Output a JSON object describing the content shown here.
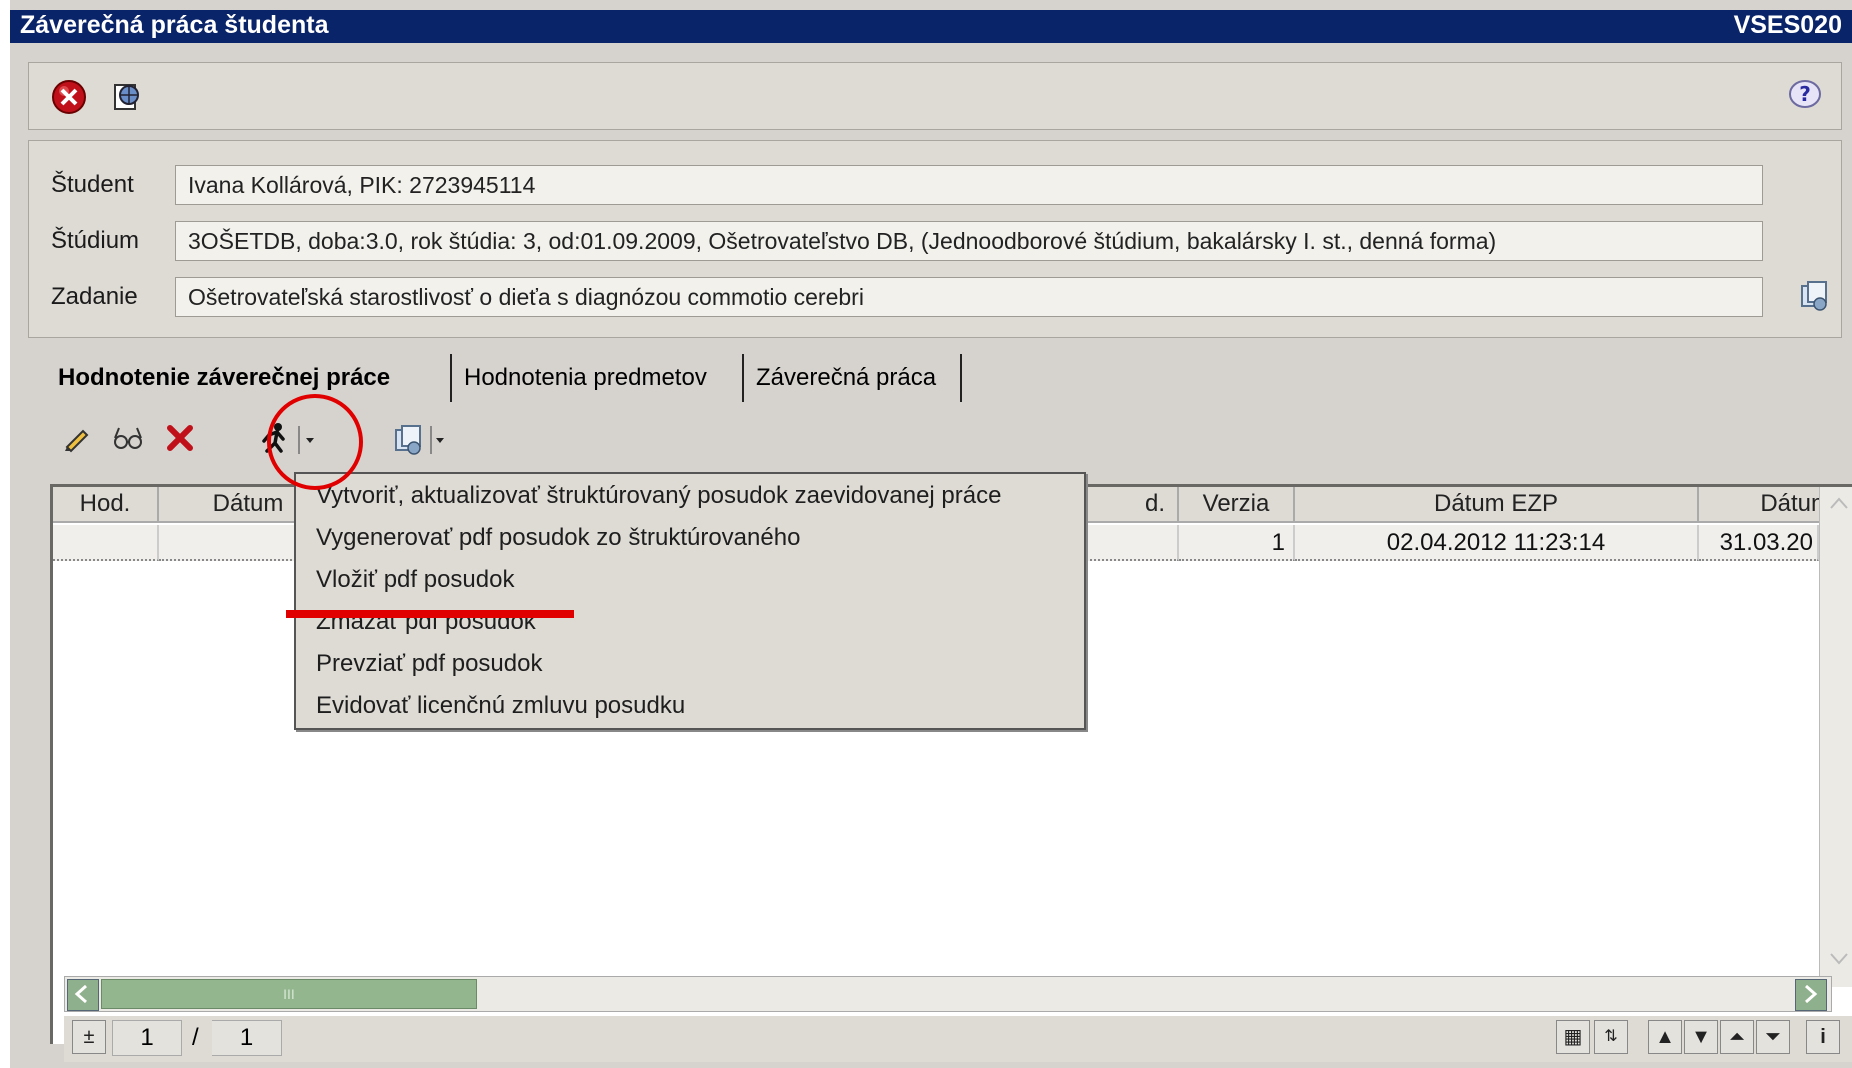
{
  "window": {
    "title": "Záverečná práca študenta",
    "code": "VSES020"
  },
  "top_toolbar": {
    "icons": [
      "close-red-icon",
      "world-report-icon",
      "help-icon"
    ]
  },
  "info": {
    "student_label": "Študent",
    "student_value": "Ivana Kollárová, PIK: 2723945114",
    "studium_label": "Štúdium",
    "studium_value": "3OŠETDB, doba:3.0, rok štúdia: 3, od:01.09.2009, Ošetrovateľstvo DB, (Jednoodborové štúdium, bakalársky I. st., denná forma)",
    "zadanie_label": "Zadanie",
    "zadanie_value": "Ošetrovateľská starostlivosť o dieťa s diagnózou commotio cerebri"
  },
  "tabs": [
    {
      "label": "Hodnotenie záverečnej práce",
      "active": true
    },
    {
      "label": "Hodnotenia predmetov",
      "active": false
    },
    {
      "label": "Záverečná práca",
      "active": false
    }
  ],
  "grid_toolbar": {
    "icons": [
      "pencil-icon",
      "glasses-icon",
      "delete-x-icon",
      "runner-icon",
      "dropdown-arrow-icon",
      "documents-icon",
      "dropdown-arrow-icon"
    ]
  },
  "grid": {
    "columns": [
      "Hod.",
      "Dátum",
      "d.",
      "Verzia",
      "Dátum EZP",
      "Dátum"
    ],
    "row": {
      "verzia": "1",
      "datum_ezp": "02.04.2012 11:23:14",
      "datum": "31.03.20"
    }
  },
  "menu": {
    "items": [
      "Vytvoriť, aktualizovať štruktúrovaný posudok zaevidovanej práce",
      "Vygenerovať pdf posudok zo štruktúrovaného",
      "Vložiť pdf posudok",
      "Zmazať pdf posudok",
      "Prevziať pdf posudok",
      "Evidovať licenčnú zmluvu posudku"
    ]
  },
  "pager": {
    "current": "1",
    "separator": "/",
    "total": "1",
    "scroll_thumb": "III"
  },
  "annotation_color": "#e00000"
}
